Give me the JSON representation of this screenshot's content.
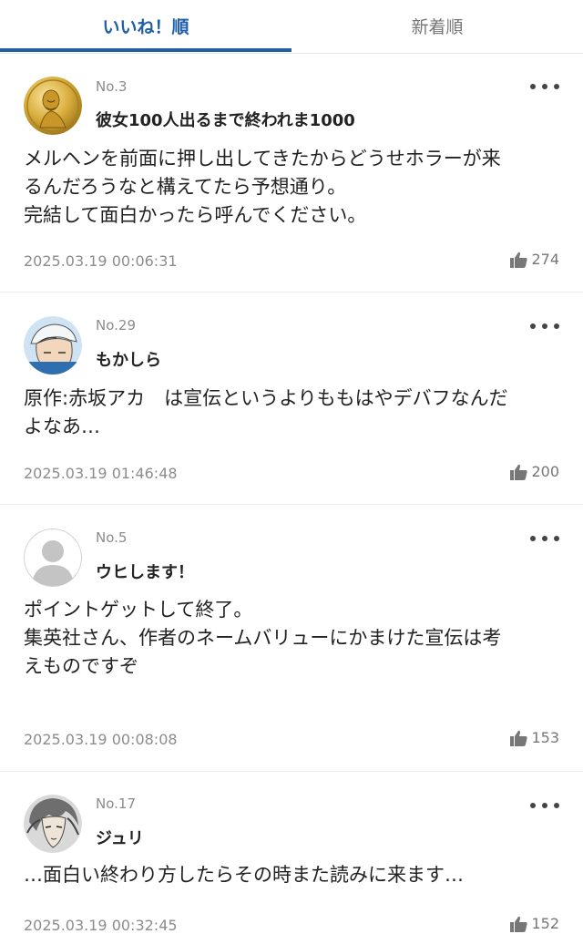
{
  "tabs": {
    "likes_order": "いいね！順",
    "newest_order": "新着順"
  },
  "colors": {
    "accent": "#1f5fa8",
    "meta_text": "#8c8c8c",
    "icon_gray": "#777777"
  },
  "comments": [
    {
      "number": "No.3",
      "username": "彼女100人出るまで終われま1000",
      "avatar": "gold-medal-avatar",
      "lines": [
        "メルヘンを前面に押し出してきたからどうせホラーが来",
        "るんだろうなと構えてたら予想通り。",
        "完結して面白かったら呼んでください。"
      ],
      "date": "2025.03.19 00:06:31",
      "likes": "274"
    },
    {
      "number": "No.29",
      "username": "もかしら",
      "avatar": "baseball-cap-character-avatar",
      "lines": [
        "原作:赤坂アカ　は宣伝というよりももはやデバフなんだ",
        "よなあ…"
      ],
      "date": "2025.03.19 01:46:48",
      "likes": "200"
    },
    {
      "number": "No.5",
      "username": "ウヒします！",
      "avatar": "default-user-avatar",
      "lines": [
        "ポイントゲットして終了。",
        "集英社さん、作者のネームバリューにかまけた宣伝は考",
        "えものですぞ"
      ],
      "date": "2025.03.19 00:08:08",
      "likes": "153"
    },
    {
      "number": "No.17",
      "username": "ジュリ",
      "avatar": "manga-character-avatar",
      "lines": [
        "…面白い終わり方したらその時また読みに来ます…"
      ],
      "date": "2025.03.19 00:32:45",
      "likes": "152"
    }
  ]
}
